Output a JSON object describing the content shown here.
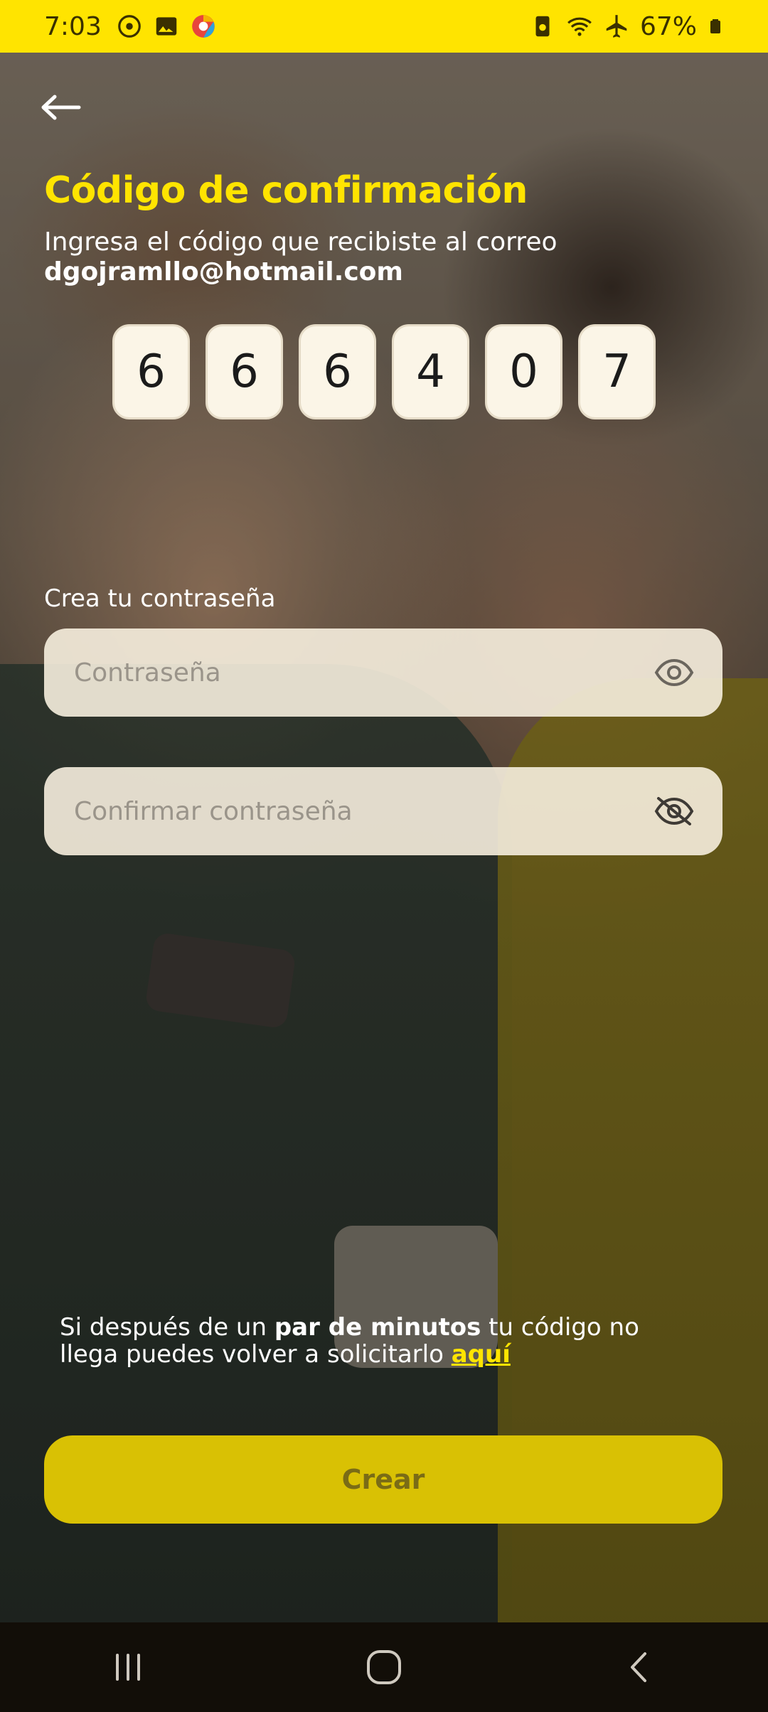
{
  "status_bar": {
    "time": "7:03",
    "battery": "67%",
    "left_icons": [
      "face-unlock-icon",
      "gallery-icon",
      "chrome-color-app-icon"
    ],
    "right_icons": [
      "battery-saver-icon",
      "wifi-icon",
      "airplane-icon",
      "battery-icon"
    ],
    "background": "#ffe400"
  },
  "header": {
    "back_icon": "arrow-left-icon",
    "title": "Código de confirmación",
    "subtitle": "Ingresa el código que recibiste al correo",
    "email": "dgojramllo@hotmail.com"
  },
  "code": {
    "digits": [
      "6",
      "6",
      "6",
      "4",
      "0",
      "7"
    ]
  },
  "password": {
    "label": "Crea tu contraseña",
    "field_placeholder": "Contraseña",
    "field_icon": "eye-icon",
    "confirm_placeholder": "Confirmar contraseña",
    "confirm_icon": "eye-off-icon"
  },
  "resend": {
    "text_1": "Si después de un ",
    "bold": "par de minutos",
    "text_2": " tu código no llega puedes volver a solicitarlo ",
    "link": "aquí"
  },
  "action": {
    "label": "Crear"
  },
  "nav": {
    "icons": [
      "recents-icon",
      "home-icon",
      "back-icon"
    ]
  },
  "colors": {
    "accent": "#ffe400",
    "button": "#d9c104",
    "button_text": "#7a6c16",
    "input_bg": "#f6eede"
  }
}
